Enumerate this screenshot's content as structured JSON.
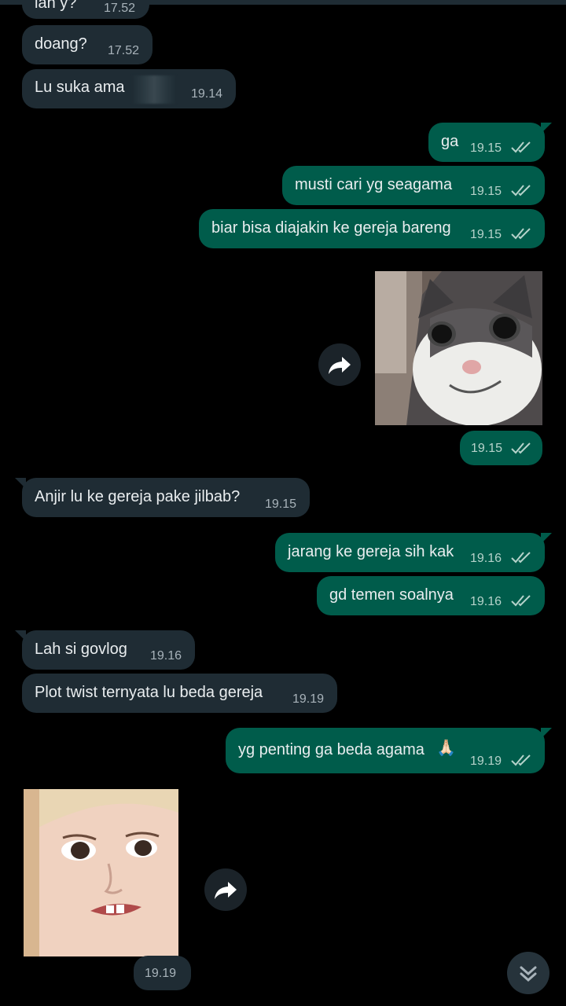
{
  "messages": [
    {
      "text": "lah y?",
      "time": "17.52"
    },
    {
      "text": "doang?",
      "time": "17.52"
    },
    {
      "text": "Lu suka ama",
      "time": "19.14"
    },
    {
      "text": "ga",
      "time": "19.15"
    },
    {
      "text": "musti cari yg seagama",
      "time": "19.15"
    },
    {
      "text": "biar bisa diajakin ke gereja bareng",
      "time": "19.15"
    },
    {
      "text": "",
      "time": "19.15"
    },
    {
      "text": "Anjir lu ke gereja pake jilbab?",
      "time": "19.15"
    },
    {
      "text": "jarang ke gereja sih kak",
      "time": "19.16"
    },
    {
      "text": "gd temen soalnya",
      "time": "19.16"
    },
    {
      "text": "Lah si govlog",
      "time": "19.16"
    },
    {
      "text": "Plot twist ternyata lu beda gereja",
      "time": "19.19"
    },
    {
      "text": "yg penting ga beda agama",
      "time": "19.19",
      "emoji": "🙏🏻"
    },
    {
      "text": "",
      "time": "19.19"
    }
  ],
  "icons": {
    "forward": "forward-arrow-icon",
    "scroll_down": "double-chevron-down-icon",
    "read_receipt": "double-check-icon"
  },
  "colors": {
    "background": "#000000",
    "incoming": "#1f2c34",
    "outgoing": "#005c4b",
    "ticks": "#b6d3cb"
  }
}
